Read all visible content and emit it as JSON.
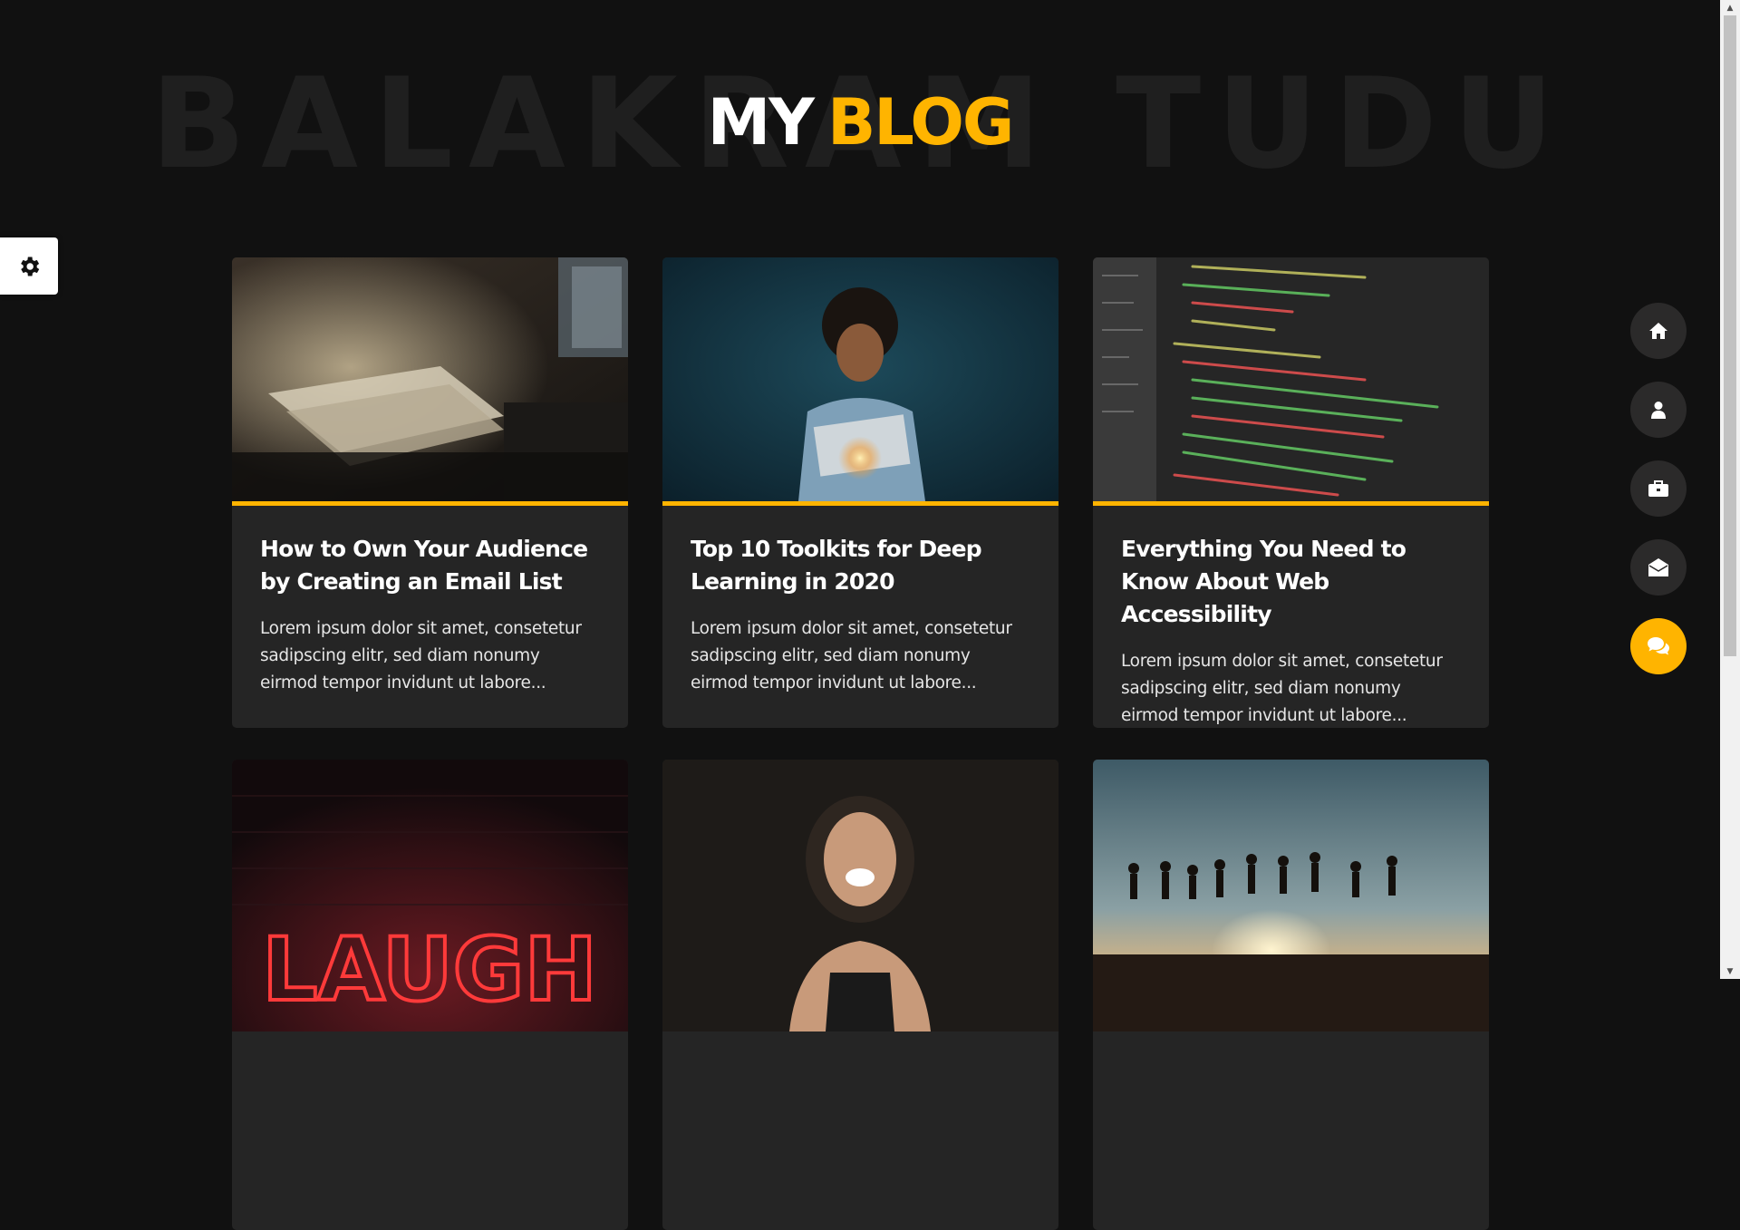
{
  "header": {
    "background_text": "BALAKRAM TUDU",
    "title_part1": "MY",
    "title_part2": "BLOG"
  },
  "settings": {
    "icon": "gear-icon"
  },
  "posts": [
    {
      "title": "How to Own Your Audience by Creating an Email List",
      "excerpt": "Lorem ipsum dolor sit amet, consetetur sadipscing elitr, sed diam nonumy eirmod tempor invidunt ut labore...",
      "image": "desk-with-papers-photo"
    },
    {
      "title": "Top 10 Toolkits for Deep Learning in 2020",
      "excerpt": "Lorem ipsum dolor sit amet, consetetur sadipscing elitr, sed diam nonumy eirmod tempor invidunt ut labore...",
      "image": "man-reading-glowing-book-photo"
    },
    {
      "title": "Everything You Need to Know About Web Accessibility",
      "excerpt": "Lorem ipsum dolor sit amet, consetetur sadipscing elitr, sed diam nonumy eirmod tempor invidunt ut labore...",
      "image": "code-editor-screen-photo"
    },
    {
      "image": "laugh-neon-sign-photo",
      "image_text": "LAUGH"
    },
    {
      "image": "laughing-woman-photo"
    },
    {
      "image": "people-jumping-sunset-photo"
    }
  ],
  "nav": [
    {
      "name": "home",
      "icon": "home-icon",
      "active": false
    },
    {
      "name": "about",
      "icon": "user-icon",
      "active": false
    },
    {
      "name": "portfolio",
      "icon": "briefcase-icon",
      "active": false
    },
    {
      "name": "contact",
      "icon": "envelope-open-icon",
      "active": false
    },
    {
      "name": "blog",
      "icon": "comments-icon",
      "active": true
    }
  ],
  "colors": {
    "background": "#111111",
    "card": "#252525",
    "accent": "#ffb400",
    "nav_button": "#2b2a2a"
  }
}
